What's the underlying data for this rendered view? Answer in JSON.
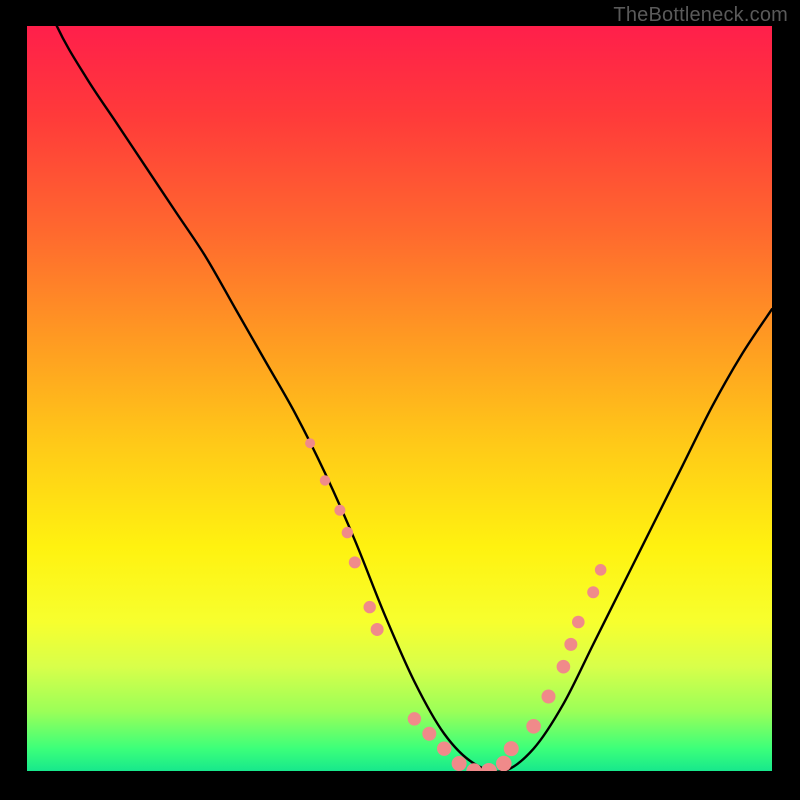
{
  "watermark": "TheBottleneck.com",
  "chart_data": {
    "type": "line",
    "title": "",
    "xlabel": "",
    "ylabel": "",
    "xlim": [
      0,
      100
    ],
    "ylim": [
      0,
      100
    ],
    "series": [
      {
        "name": "curve",
        "x": [
          0,
          4,
          8,
          12,
          16,
          20,
          24,
          28,
          32,
          36,
          40,
          44,
          48,
          52,
          56,
          60,
          64,
          68,
          72,
          76,
          80,
          84,
          88,
          92,
          96,
          100
        ],
        "y": [
          110,
          100,
          93,
          87,
          81,
          75,
          69,
          62,
          55,
          48,
          40,
          31,
          21,
          12,
          5,
          1,
          0,
          3,
          9,
          17,
          25,
          33,
          41,
          49,
          56,
          62
        ]
      }
    ],
    "markers": {
      "name": "highlighted-points",
      "color": "#f08a8a",
      "radius_px_scale": [
        5,
        8
      ],
      "points_xy": [
        [
          38,
          44
        ],
        [
          40,
          39
        ],
        [
          42,
          35
        ],
        [
          43,
          32
        ],
        [
          44,
          28
        ],
        [
          46,
          22
        ],
        [
          47,
          19
        ],
        [
          52,
          7
        ],
        [
          54,
          5
        ],
        [
          56,
          3
        ],
        [
          58,
          1
        ],
        [
          60,
          0
        ],
        [
          62,
          0
        ],
        [
          64,
          1
        ],
        [
          65,
          3
        ],
        [
          68,
          6
        ],
        [
          70,
          10
        ],
        [
          72,
          14
        ],
        [
          73,
          17
        ],
        [
          74,
          20
        ],
        [
          76,
          24
        ],
        [
          77,
          27
        ]
      ]
    }
  }
}
